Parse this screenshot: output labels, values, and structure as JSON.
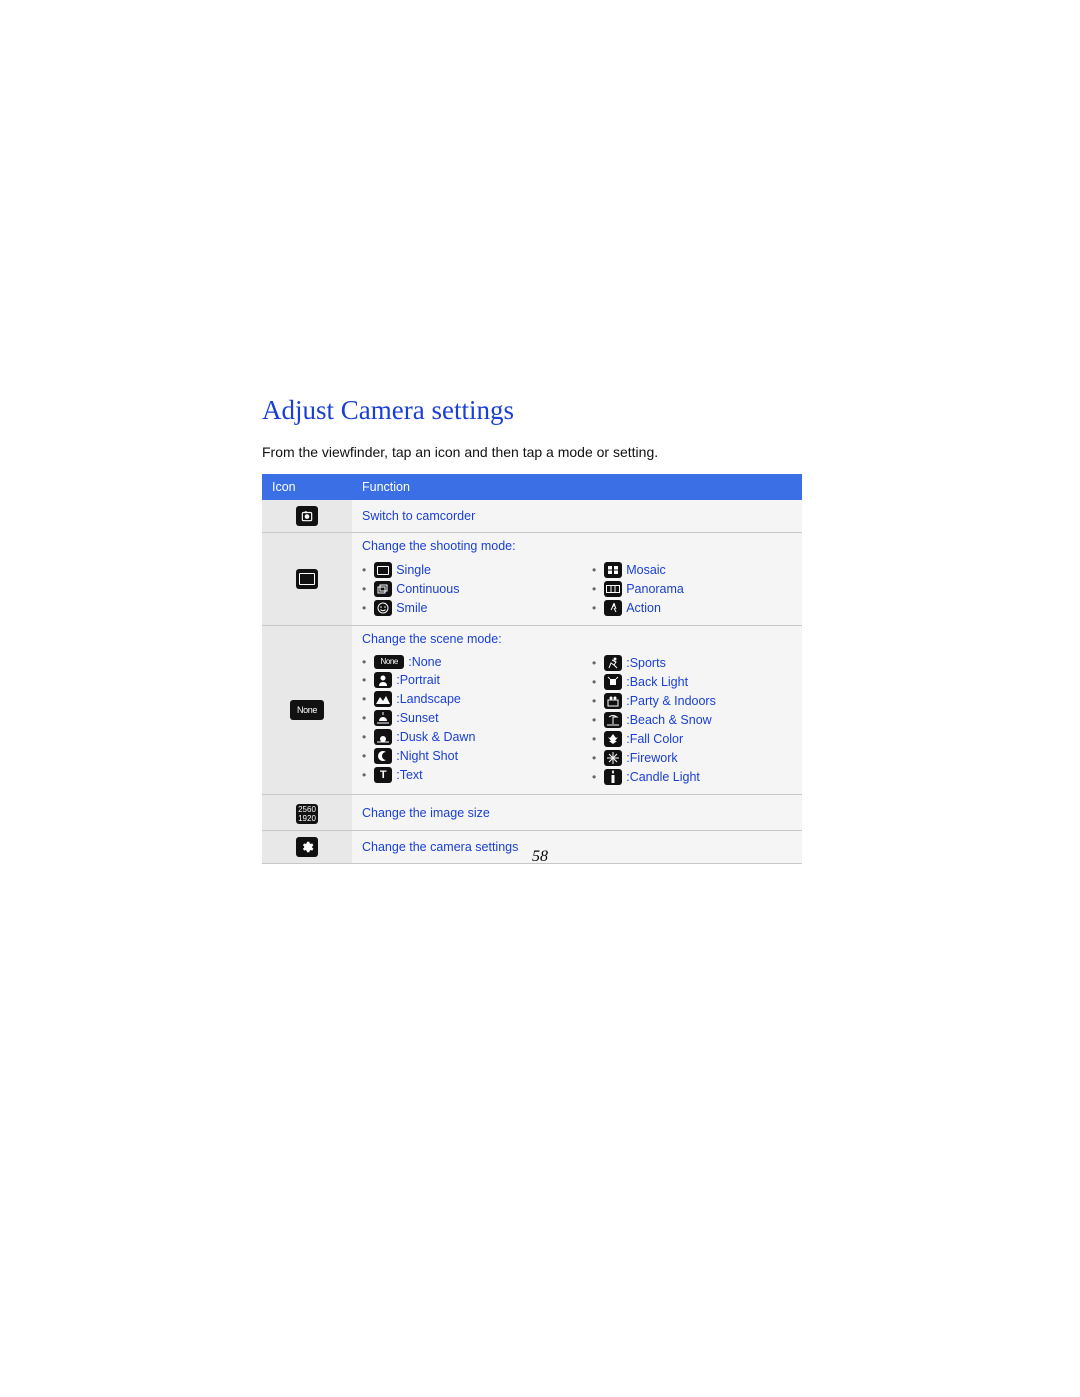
{
  "title": "Adjust Camera settings",
  "intro": "From the viewfinder, tap an icon and then tap a mode or setting.",
  "table": {
    "headers": {
      "icon": "Icon",
      "function": "Function"
    },
    "row_switch": {
      "label": "Switch to camcorder"
    },
    "row_size": {
      "label": "Change the image size",
      "icon_text_top": "2560",
      "icon_text_bottom": "1920"
    },
    "row_settings": {
      "label": "Change the camera settings"
    },
    "row_shooting": {
      "heading": "Change the shooting mode:",
      "left": [
        {
          "name": "Single"
        },
        {
          "name": "Continuous"
        },
        {
          "name": "Smile"
        }
      ],
      "right": [
        {
          "name": "Mosaic"
        },
        {
          "name": "Panorama"
        },
        {
          "name": "Action"
        }
      ]
    },
    "row_scene": {
      "heading": "Change the scene mode:",
      "left": [
        {
          "name": "None",
          "icon_label": "None"
        },
        {
          "name": "Portrait"
        },
        {
          "name": "Landscape"
        },
        {
          "name": "Sunset"
        },
        {
          "name": "Dusk & Dawn"
        },
        {
          "name": "Night Shot"
        },
        {
          "name": "Text"
        }
      ],
      "right": [
        {
          "name": "Sports"
        },
        {
          "name": "Back Light"
        },
        {
          "name": "Party & Indoors"
        },
        {
          "name": "Beach & Snow"
        },
        {
          "name": "Fall Color"
        },
        {
          "name": "Firework"
        },
        {
          "name": "Candle Light"
        }
      ],
      "row_icon_label": "None"
    }
  },
  "page_number": "58"
}
